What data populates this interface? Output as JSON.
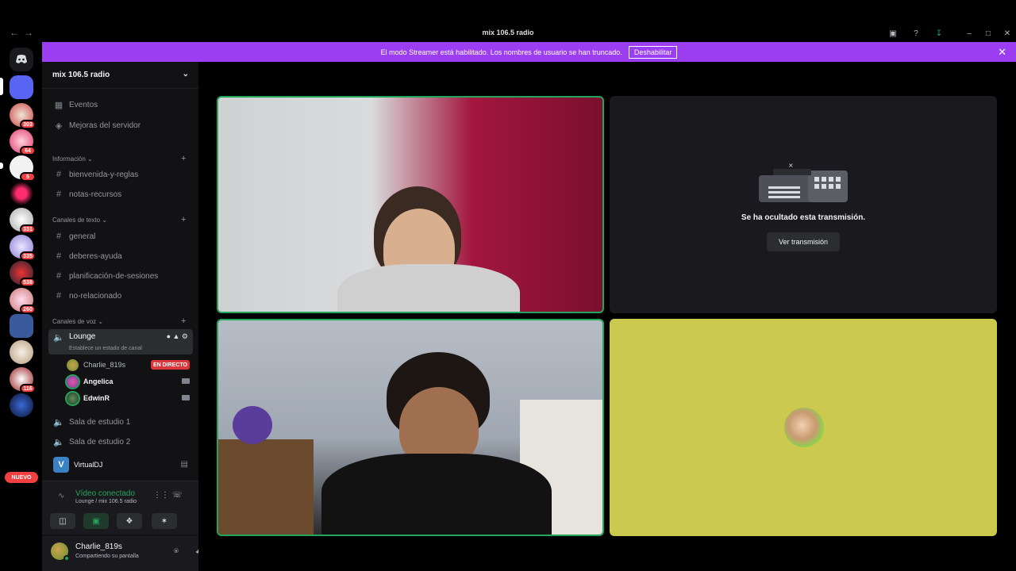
{
  "titlebar": {
    "title": "mix 106.5 radio"
  },
  "banner": {
    "text": "El modo Streamer está habilitado. Los nombres de usuario se han truncado.",
    "button": "Deshabilitar"
  },
  "rail": {
    "badges": [
      "303",
      "64",
      "5",
      "331",
      "335",
      "538",
      "260",
      "116"
    ],
    "new_badge": "NUEVO"
  },
  "server": {
    "name": "mix 106.5 radio"
  },
  "top_items": [
    {
      "label": "Eventos",
      "icon": "calendar-icon"
    },
    {
      "label": "Mejoras del servidor",
      "icon": "boost-icon"
    }
  ],
  "categories": {
    "info": {
      "label": "Información",
      "channels": [
        "bienvenida-y-reglas",
        "notas-recursos"
      ]
    },
    "text": {
      "label": "Canales de texto",
      "channels": [
        "general",
        "deberes-ayuda",
        "planificación-de-sesiones",
        "no-relacionado"
      ]
    },
    "voice": {
      "label": "Canales de voz",
      "active_channel": "Lounge",
      "active_hint": "Establece un estado de canal",
      "users": [
        "Charlie_819s",
        "Angelica",
        "EdwinR"
      ],
      "live_label": "EN DIRECTO",
      "other_channels": [
        "Sala de estudio 1",
        "Sala de estudio 2"
      ]
    }
  },
  "activity": {
    "label": "VirtualDJ",
    "icon_letter": "V"
  },
  "voice_panel": {
    "status": "Vídeo conectado",
    "sub": "Lounge / mix 106.5 radio"
  },
  "user_panel": {
    "name": "Charlie_819s",
    "status": "Compartiendo su pantalla"
  },
  "stage": {
    "hidden_caption": "Se ha ocultado esta transmisión.",
    "watch_button": "Ver transmisión"
  },
  "colors": {
    "accent": "#9b3df0",
    "speaking": "#23a55a",
    "live": "#da373c",
    "tile_yellow": "#ccc94f"
  }
}
